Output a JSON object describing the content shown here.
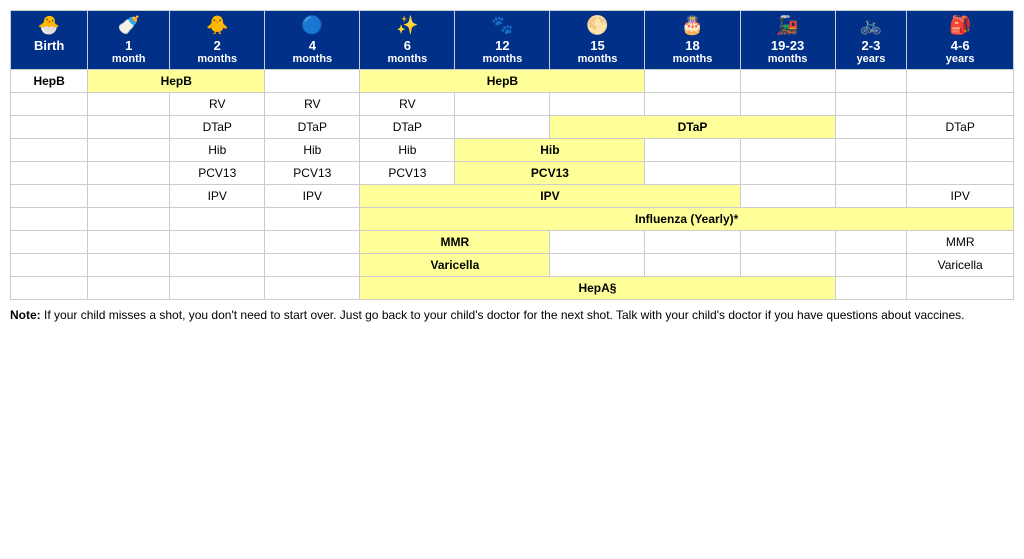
{
  "table": {
    "headers": [
      {
        "id": "birth",
        "icon": "🐣",
        "line1": "Birth",
        "line2": ""
      },
      {
        "id": "1mo",
        "icon": "🍼",
        "line1": "1",
        "line2": "month"
      },
      {
        "id": "2mo",
        "icon": "🐥",
        "line1": "2",
        "line2": "months"
      },
      {
        "id": "4mo",
        "icon": "🔵",
        "line1": "4",
        "line2": "months"
      },
      {
        "id": "6mo",
        "icon": "🌟",
        "line1": "6",
        "line2": "months"
      },
      {
        "id": "12mo",
        "icon": "🐾",
        "line1": "12",
        "line2": "months"
      },
      {
        "id": "15mo",
        "icon": "🌕",
        "line1": "15",
        "line2": "months"
      },
      {
        "id": "18mo",
        "icon": "🎂",
        "line1": "18",
        "line2": "months"
      },
      {
        "id": "19-23mo",
        "icon": "🚂",
        "line1": "19-23",
        "line2": "months"
      },
      {
        "id": "2-3yr",
        "icon": "🚲",
        "line1": "2-3",
        "line2": "years"
      },
      {
        "id": "4-6yr",
        "icon": "🎒",
        "line1": "4-6",
        "line2": "years"
      }
    ],
    "rows": [
      {
        "vaccine": "HepB",
        "cells": [
          {
            "col": "birth",
            "label": "HepB",
            "style": "none"
          },
          {
            "col": "1mo",
            "label": "HepB",
            "span": 2,
            "style": "yellow"
          },
          {
            "col": "4mo",
            "label": "",
            "style": "none"
          },
          {
            "col": "6mo",
            "label": "HepB",
            "span": 3,
            "style": "yellow"
          },
          {
            "col": "18mo",
            "label": "",
            "style": "none"
          },
          {
            "col": "19-23mo",
            "label": "",
            "style": "none"
          },
          {
            "col": "2-3yr",
            "label": "",
            "style": "none"
          },
          {
            "col": "4-6yr",
            "label": "",
            "style": "none"
          }
        ]
      }
    ],
    "vaccine_rows": [
      {
        "name": "HepB"
      },
      {
        "name": "RV"
      },
      {
        "name": "DTaP"
      },
      {
        "name": "Hib"
      },
      {
        "name": "PCV13"
      },
      {
        "name": "IPV"
      },
      {
        "name": "Influenza (Yearly)*"
      },
      {
        "name": "MMR"
      },
      {
        "name": "Varicella"
      },
      {
        "name": "HepA§"
      }
    ]
  },
  "note": {
    "bold_text": "Note:",
    "text": " If your child misses a shot, you don't need to start over. Just go back to your child's doctor for the next shot. Talk with your child's doctor if you have questions about vaccines."
  }
}
